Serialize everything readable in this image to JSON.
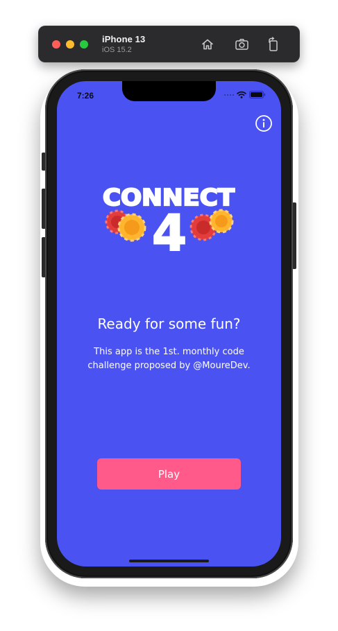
{
  "simulator": {
    "device_name": "iPhone 13",
    "os_version": "iOS 15.2",
    "icons": {
      "home": "home-icon",
      "screenshot": "camera-icon",
      "rotate": "rotate-icon"
    }
  },
  "status_bar": {
    "time": "7:26",
    "icons": [
      "signal-icon",
      "wifi-icon",
      "battery-icon"
    ]
  },
  "app": {
    "logo": {
      "word": "CONNECT",
      "number": "4"
    },
    "info_icon": "info-icon",
    "headline": "Ready for some fun?",
    "description": "This app is the 1st. monthly code challenge proposed by @MoureDev.",
    "play_label": "Play"
  },
  "colors": {
    "background": "#4a53f2",
    "play_button": "#ff5a8a",
    "chip_red": "#e23c3c",
    "chip_yellow": "#ffb52e",
    "traffic_close": "#ff5f57",
    "traffic_min": "#febc2e",
    "traffic_max": "#28c840"
  }
}
